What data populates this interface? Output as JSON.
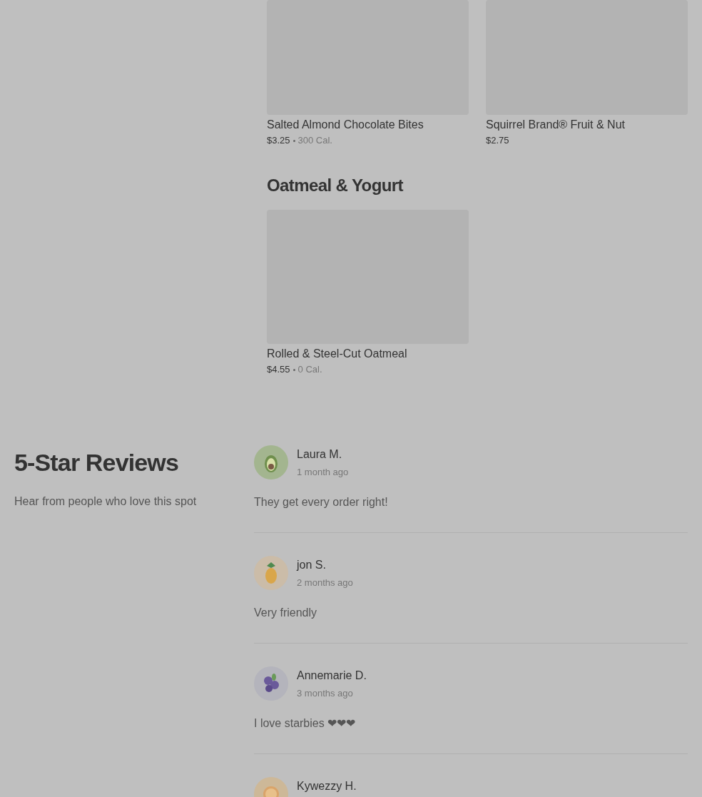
{
  "menu_sections": [
    {
      "items": [
        {
          "name": "Salted Almond Chocolate Bites",
          "price": "$3.25",
          "calories": "300 Cal."
        },
        {
          "name": "Squirrel Brand® Fruit & Nut",
          "price": "$2.75"
        }
      ]
    },
    {
      "title": "Oatmeal & Yogurt",
      "items": [
        {
          "name": "Rolled & Steel-Cut Oatmeal",
          "price": "$4.55",
          "calories": "0 Cal."
        }
      ]
    }
  ],
  "reviews_section": {
    "title": "5-Star Reviews",
    "subtitle": "Hear from people who love this spot"
  },
  "reviews": [
    {
      "kind": "avocado",
      "name": "Laura M.",
      "time": "1 month ago",
      "text": "They get every order right!"
    },
    {
      "kind": "pineapple",
      "name": "jon S.",
      "time": "2 months ago",
      "text": "Very friendly"
    },
    {
      "kind": "blueberry",
      "name": "Annemarie D.",
      "time": "3 months ago",
      "text": "I love starbies ❤❤❤"
    },
    {
      "kind": "orange",
      "name": "Kywezzy H."
    }
  ]
}
